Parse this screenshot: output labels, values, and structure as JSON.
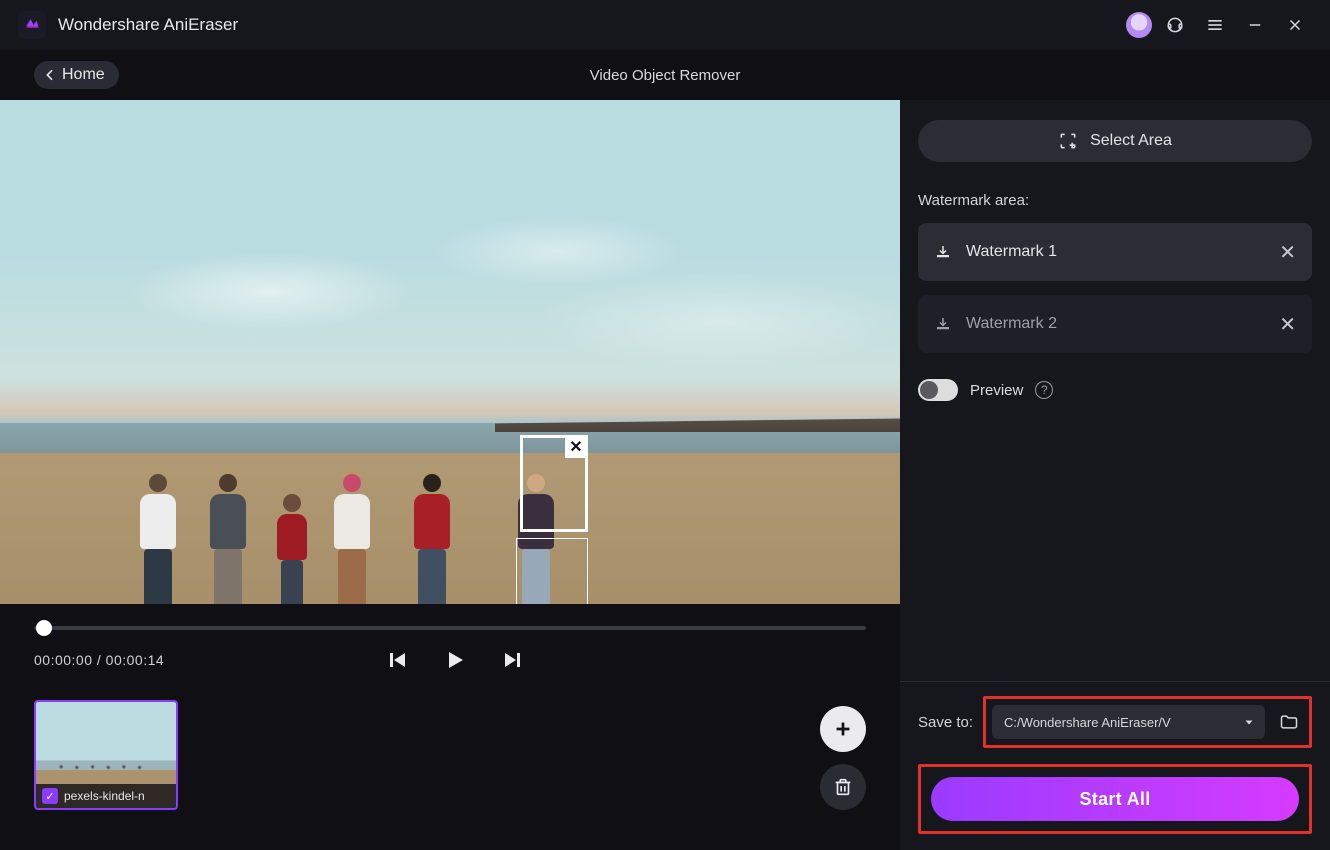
{
  "app": {
    "title": "Wondershare AniEraser"
  },
  "subheader": {
    "home": "Home",
    "page_title": "Video Object Remover"
  },
  "player": {
    "current_time": "00:00:00",
    "duration": "00:00:14"
  },
  "thumbnail": {
    "file_label": "pexels-kindel-n"
  },
  "right": {
    "select_area": "Select Area",
    "watermark_heading": "Watermark area:",
    "watermarks": [
      "Watermark 1",
      "Watermark 2"
    ],
    "preview_label": "Preview",
    "save_to_label": "Save to:",
    "save_path": "C:/Wondershare AniEraser/V",
    "start_label": "Start All"
  }
}
